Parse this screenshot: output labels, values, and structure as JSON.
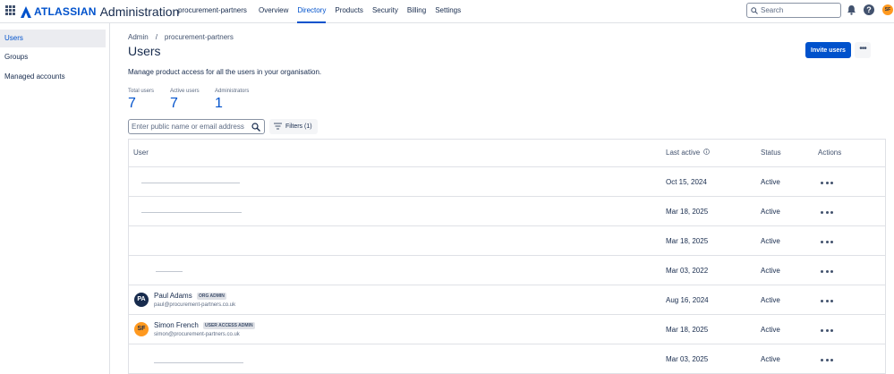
{
  "topbar": {
    "brand_word": "ATLASSIAN",
    "brand_product": "Administration",
    "org_name": "procurement-partners",
    "nav": [
      {
        "label": "Overview",
        "active": false
      },
      {
        "label": "Directory",
        "active": true
      },
      {
        "label": "Products",
        "active": false
      },
      {
        "label": "Security",
        "active": false
      },
      {
        "label": "Billing",
        "active": false
      },
      {
        "label": "Settings",
        "active": false
      }
    ],
    "search_placeholder": "Search",
    "help_glyph": "?",
    "profile_initials": "SF",
    "icons": [
      "app-switcher-icon",
      "atlassian-logo-icon",
      "search-icon",
      "bell-icon",
      "help-icon"
    ]
  },
  "sidebar": {
    "items": [
      {
        "label": "Users",
        "active": true
      },
      {
        "label": "Groups",
        "active": false
      },
      {
        "label": "Managed accounts",
        "active": false
      }
    ]
  },
  "breadcrumb": {
    "root": "Admin",
    "sep": "/",
    "current": "procurement-partners"
  },
  "page": {
    "title": "Users",
    "invite_label": "Invite users",
    "more_glyph": "•••",
    "description": "Manage product access for all the users in your organisation."
  },
  "stats": [
    {
      "label": "Total users",
      "value": "7"
    },
    {
      "label": "Active users",
      "value": "7"
    },
    {
      "label": "Administrators",
      "value": "1"
    }
  ],
  "filter": {
    "placeholder": "Enter public name or email address",
    "filters_label": "Filters (1)"
  },
  "table": {
    "headers": {
      "user": "User",
      "last_active": "Last active",
      "status": "Status",
      "actions": "Actions"
    },
    "rows": [
      {
        "name": "",
        "email": "",
        "badge": "",
        "initials": "",
        "last_active": "Oct 15, 2024",
        "status": "Active"
      },
      {
        "name": "",
        "email": "",
        "badge": "",
        "initials": "",
        "last_active": "Mar 18, 2025",
        "status": "Active"
      },
      {
        "name": "",
        "email": "",
        "badge": "",
        "initials": "",
        "last_active": "Mar 18, 2025",
        "status": "Active"
      },
      {
        "name": "",
        "email": "",
        "badge": "",
        "initials": "",
        "last_active": "Mar 03, 2022",
        "status": "Active"
      },
      {
        "name": "Paul Adams",
        "email": "paul@procurement-partners.co.uk",
        "badge": "ORG ADMIN",
        "initials": "PA",
        "avatar_color": "#172b4d",
        "avatar_text_color": "#ffffff",
        "last_active": "Aug 16, 2024",
        "status": "Active"
      },
      {
        "name": "Simon French",
        "email": "simon@procurement-partners.co.uk",
        "badge": "USER ACCESS ADMIN",
        "initials": "SF",
        "avatar_color": "#ff991f",
        "avatar_text_color": "#172b4d",
        "last_active": "Mar 18, 2025",
        "status": "Active"
      },
      {
        "name": "",
        "email": "",
        "badge": "",
        "initials": "",
        "last_active": "Mar 03, 2025",
        "status": "Active"
      }
    ]
  },
  "colors": {
    "accent": "#0052cc",
    "text": "#172b4d",
    "muted": "#5e6c84",
    "border": "#dfe1e6"
  }
}
